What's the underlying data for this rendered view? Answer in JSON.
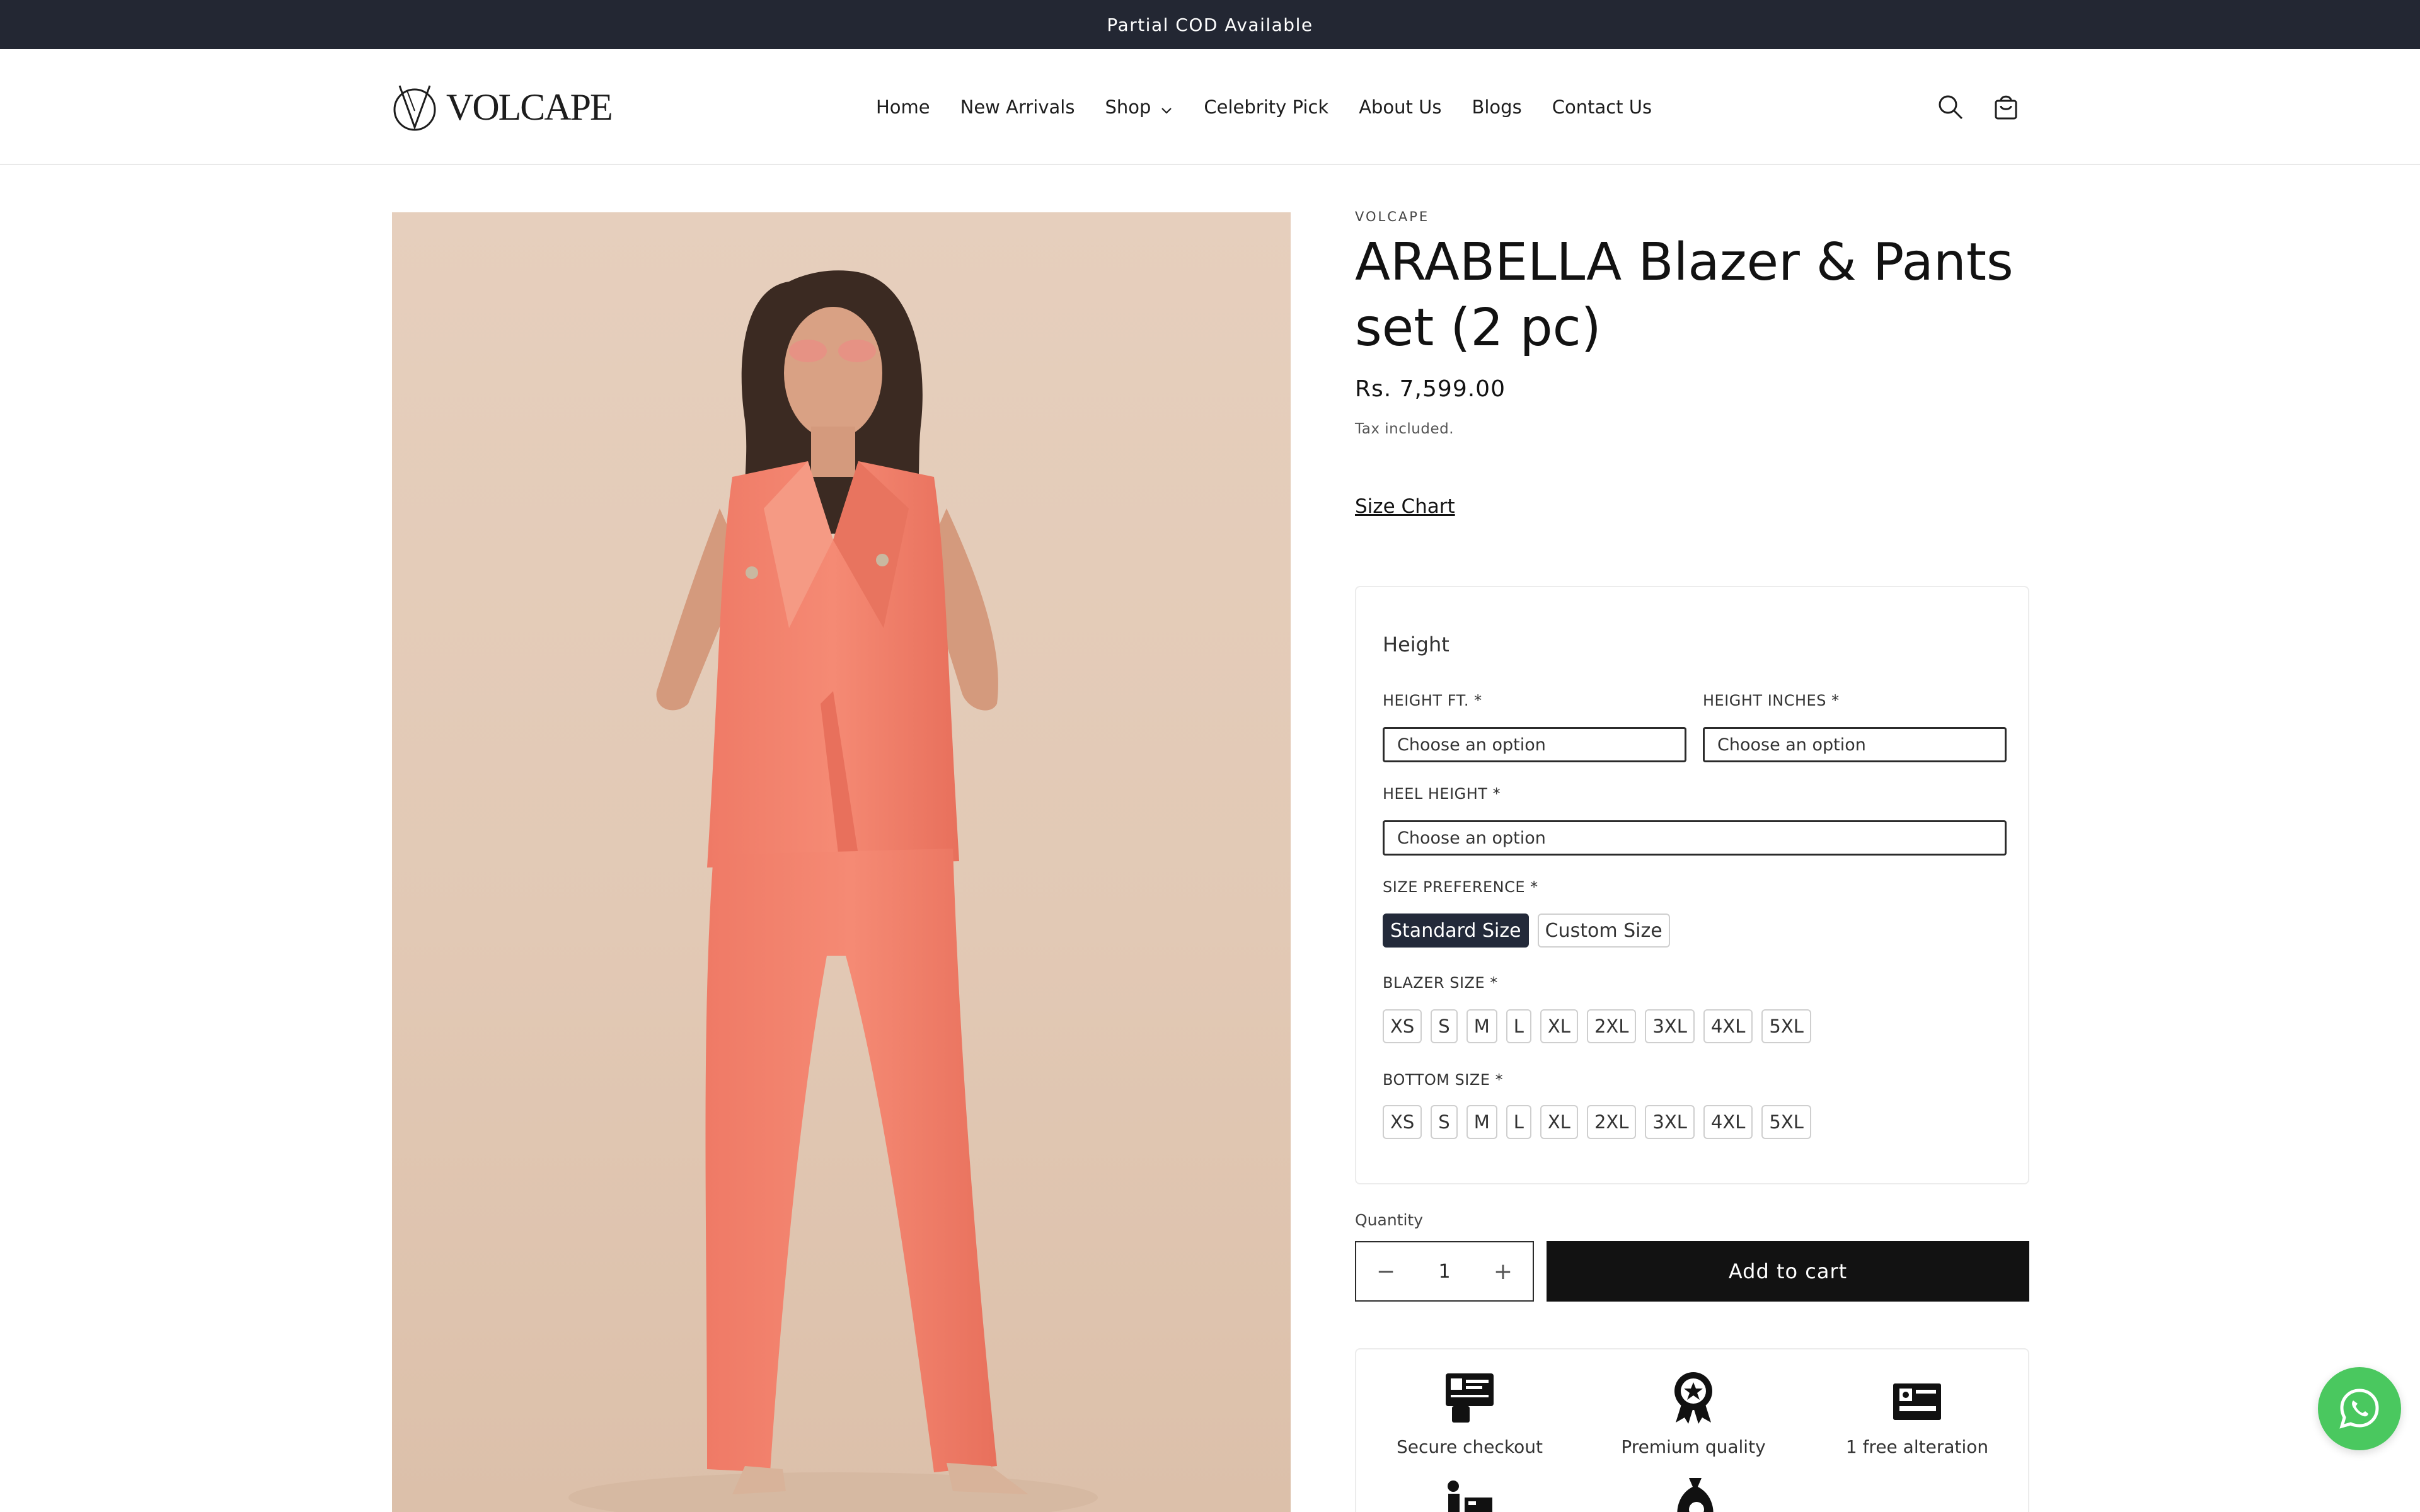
{
  "announcement": {
    "text": "Partial COD Available",
    "bg_color": "#232733"
  },
  "header": {
    "logo_text": "VOLCAPE",
    "nav": [
      {
        "label": "Home"
      },
      {
        "label": "New Arrivals"
      },
      {
        "label": "Shop",
        "has_dropdown": true
      },
      {
        "label": "Celebrity Pick"
      },
      {
        "label": "About Us"
      },
      {
        "label": "Blogs"
      },
      {
        "label": "Contact Us"
      }
    ],
    "icons": [
      "search-icon",
      "cart-icon"
    ]
  },
  "product": {
    "vendor": "VOLCAPE",
    "title": "ARABELLA Blazer & Pants set (2 pc)",
    "price": "Rs. 7,599.00",
    "tax_note": "Tax included.",
    "size_chart_link": "Size Chart",
    "image_colors": {
      "background": "#e2c9b5",
      "outfit": "#f4826e"
    }
  },
  "options": {
    "heading": "Height",
    "height_ft": {
      "label": "HEIGHT FT. *",
      "placeholder": "Choose an option"
    },
    "height_inches": {
      "label": "HEIGHT INCHES *",
      "placeholder": "Choose an option"
    },
    "heel_height": {
      "label": "HEEL HEIGHT *",
      "placeholder": "Choose an option"
    },
    "size_preference": {
      "label": "SIZE PREFERENCE *",
      "choices": [
        "Standard Size",
        "Custom Size"
      ],
      "selected": "Standard Size"
    },
    "blazer_size": {
      "label": "BLAZER SIZE *",
      "choices": [
        "XS",
        "S",
        "M",
        "L",
        "XL",
        "2XL",
        "3XL",
        "4XL",
        "5XL"
      ]
    },
    "bottom_size": {
      "label": "BOTTOM SIZE *",
      "choices": [
        "XS",
        "S",
        "M",
        "L",
        "XL",
        "2XL",
        "3XL",
        "4XL",
        "5XL"
      ]
    }
  },
  "purchase": {
    "quantity_label": "Quantity",
    "quantity_value": "1",
    "minus": "−",
    "plus": "+",
    "add_to_cart": "Add to cart"
  },
  "features": [
    {
      "label": "Secure checkout",
      "icon": "secure-checkout-icon"
    },
    {
      "label": "Premium quality",
      "icon": "premium-quality-icon"
    },
    {
      "label": "1 free alteration",
      "icon": "alteration-icon"
    }
  ],
  "whatsapp": {
    "icon": "whatsapp-icon",
    "color": "#4ac85f"
  }
}
